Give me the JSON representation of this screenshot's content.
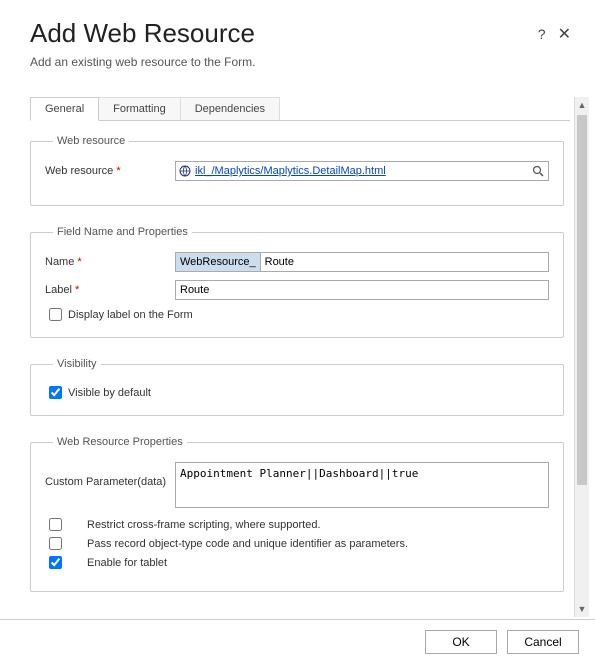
{
  "header": {
    "title": "Add Web Resource",
    "subtitle": "Add an existing web resource to the Form."
  },
  "tabs": [
    {
      "label": "General"
    },
    {
      "label": "Formatting"
    },
    {
      "label": "Dependencies"
    }
  ],
  "webResource": {
    "legend": "Web resource",
    "label": "Web resource",
    "value": "ikl_/Maplytics/Maplytics.DetailMap.html"
  },
  "fieldProps": {
    "legend": "Field Name and Properties",
    "name_label": "Name",
    "name_prefix": "WebResource_",
    "name_value": "Route",
    "label_label": "Label",
    "label_value": "Route",
    "display_label_text": "Display label on the Form"
  },
  "visibility": {
    "legend": "Visibility",
    "visible_text": "Visible by default"
  },
  "wrProps": {
    "legend": "Web Resource Properties",
    "custom_param_label": "Custom Parameter(data)",
    "custom_param_value": "Appointment Planner||Dashboard||true",
    "restrict_text": "Restrict cross-frame scripting, where supported.",
    "pass_record_text": "Pass record object-type code and unique identifier as parameters.",
    "enable_tablet_text": "Enable for tablet"
  },
  "footer": {
    "ok": "OK",
    "cancel": "Cancel"
  }
}
